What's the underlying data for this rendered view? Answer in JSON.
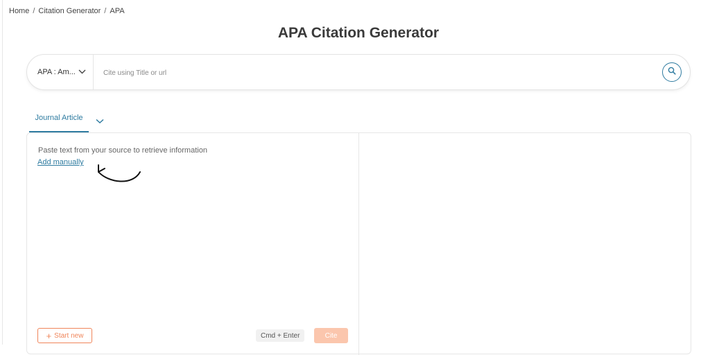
{
  "breadcrumb": {
    "items": [
      "Home",
      "Citation Generator",
      "APA"
    ],
    "separator": "/"
  },
  "page_title": "APA Citation Generator",
  "search": {
    "style_label": "APA : Am...",
    "placeholder": "Cite using Title or url",
    "value": ""
  },
  "tabs": {
    "active_label": "Journal Article"
  },
  "panel": {
    "paste_text": "Paste text from your source to retrieve information",
    "add_manually": "Add manually",
    "start_new_label": "Start new",
    "shortcut_hint": "Cmd + Enter",
    "cite_label": "Cite"
  },
  "icons": {
    "style_dropdown": "chevron-down-icon",
    "search": "search-icon",
    "tab_menu": "chevron-down-icon",
    "start_new": "plus-icon",
    "hint_arrow": "curved-arrow-icon"
  },
  "colors": {
    "accent": "#2e7ba0",
    "start_new": "#f0855a",
    "cite_disabled": "#fbc6ad"
  }
}
